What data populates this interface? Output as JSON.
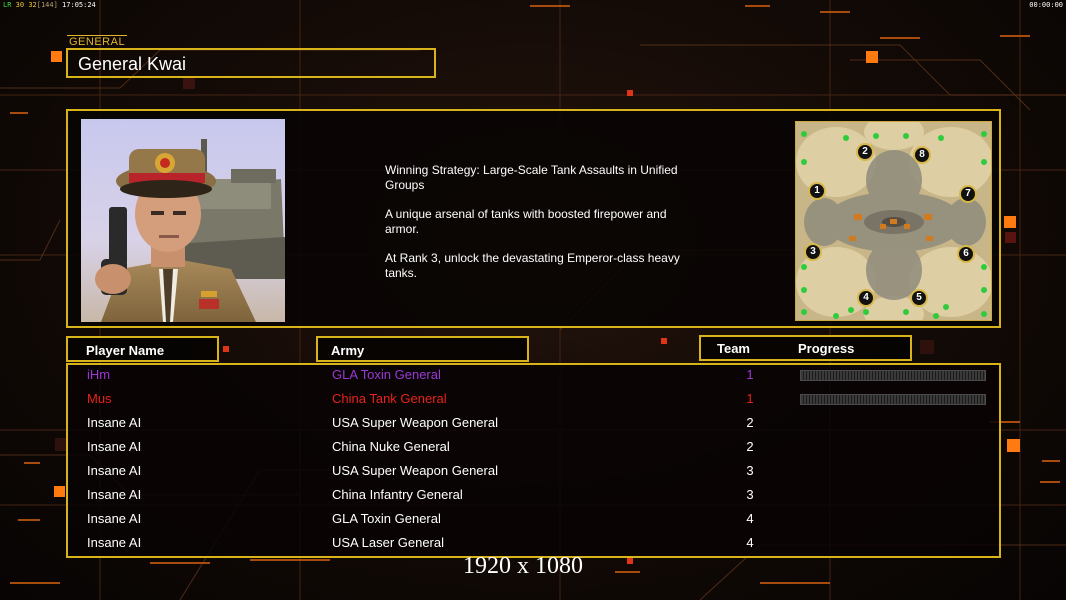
{
  "hud": {
    "stats_prefix": "LR",
    "stats_a": "30",
    "stats_b": "32",
    "stats_bracket": "[144]",
    "clock": "17:05:24",
    "timer": "00:00:00"
  },
  "general": {
    "section_label": "GENERAL",
    "name": "General Kwai",
    "description": [
      "Winning Strategy: Large-Scale Tank Assaults in Unified\n Groups",
      "A unique arsenal of tanks with boosted firepower and\n armor.",
      "At Rank 3, unlock the devastating Emperor-class heavy\n tanks."
    ]
  },
  "map": {
    "start_positions": [
      "1",
      "2",
      "3",
      "4",
      "5",
      "6",
      "7",
      "8"
    ]
  },
  "table": {
    "headers": {
      "player": "Player Name",
      "army": "Army",
      "team": "Team",
      "progress": "Progress"
    },
    "rows": [
      {
        "name": "iHm",
        "army": "GLA Toxin General",
        "team": "1",
        "color": "#9a38d6",
        "has_progress": true
      },
      {
        "name": "Mus",
        "army": "China Tank General",
        "team": "1",
        "color": "#e8231c",
        "has_progress": true
      },
      {
        "name": "Insane AI",
        "army": "USA Super Weapon General",
        "team": "2",
        "color": "#ffffff",
        "has_progress": false
      },
      {
        "name": "Insane AI",
        "army": "China Nuke General",
        "team": "2",
        "color": "#ffffff",
        "has_progress": false
      },
      {
        "name": "Insane AI",
        "army": "USA Super Weapon General",
        "team": "3",
        "color": "#ffffff",
        "has_progress": false
      },
      {
        "name": "Insane AI",
        "army": "China Infantry General",
        "team": "3",
        "color": "#ffffff",
        "has_progress": false
      },
      {
        "name": "Insane AI",
        "army": "GLA Toxin General",
        "team": "4",
        "color": "#ffffff",
        "has_progress": false
      },
      {
        "name": "Insane AI",
        "army": "USA Laser General",
        "team": "4",
        "color": "#ffffff",
        "has_progress": false
      }
    ]
  },
  "footer": {
    "resolution": "1920 x 1080"
  },
  "colors": {
    "frame_gold": "#d8b31a",
    "accent_orange": "#ff7a10"
  }
}
